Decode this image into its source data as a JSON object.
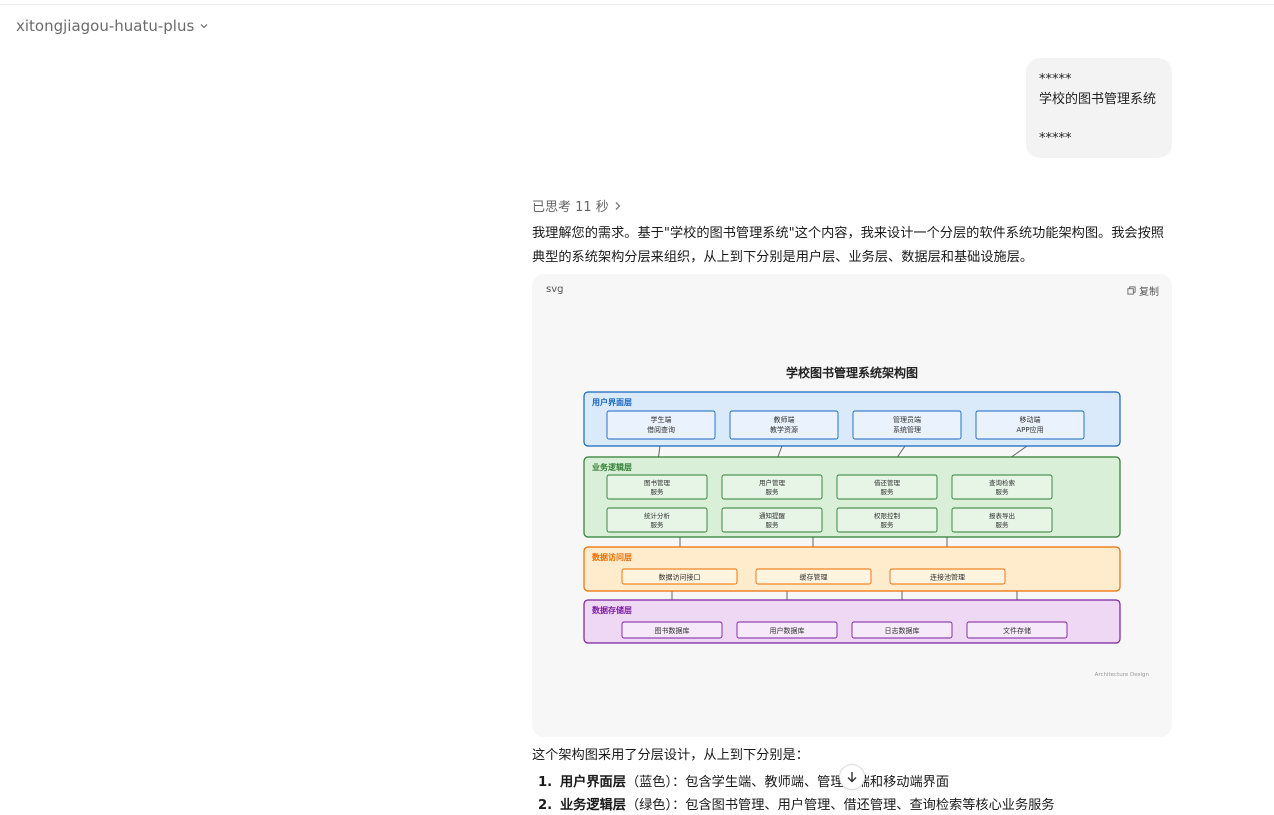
{
  "header": {
    "model_name": "xitongjiagou-huatu-plus"
  },
  "user_message": {
    "line1": "*****",
    "line2": "学校的图书管理系统",
    "line3": "*****"
  },
  "assistant": {
    "thought_label": "已思考 11 秒",
    "intro": "我理解您的需求。基于\"学校的图书管理系统\"这个内容，我来设计一个分层的软件系统功能架构图。我会按照典型的系统架构分层来组织，从上到下分别是用户层、业务层、数据层和基础设施层。",
    "code_block": {
      "language": "svg",
      "copy_label": "复制",
      "diagram": {
        "title": "学校图书管理系统架构图",
        "footer": "Architecture Design",
        "layers": [
          {
            "name": "用户界面层",
            "color": "#1565c0",
            "fill": "#dbeafb",
            "boxes": [
              [
                "学生端",
                "借阅查询"
              ],
              [
                "教师端",
                "教学资源"
              ],
              [
                "管理员端",
                "系统管理"
              ],
              [
                "移动端",
                "APP应用"
              ]
            ]
          },
          {
            "name": "业务逻辑层",
            "color": "#2e7d32",
            "fill": "#d9efd8",
            "boxes": [
              [
                "图书管理",
                "服务"
              ],
              [
                "用户管理",
                "服务"
              ],
              [
                "借还管理",
                "服务"
              ],
              [
                "查询检索",
                "服务"
              ],
              [
                "统计分析",
                "服务"
              ],
              [
                "通知提醒",
                "服务"
              ],
              [
                "权限控制",
                "服务"
              ],
              [
                "报表导出",
                "服务"
              ]
            ]
          },
          {
            "name": "数据访问层",
            "color": "#ef6c00",
            "fill": "#ffeccc",
            "boxes": [
              [
                "数据访问接口"
              ],
              [
                "缓存管理"
              ],
              [
                "连接池管理"
              ]
            ]
          },
          {
            "name": "数据存储层",
            "color": "#7b1fa2",
            "fill": "#eed8f3",
            "boxes": [
              [
                "图书数据库"
              ],
              [
                "用户数据库"
              ],
              [
                "日志数据库"
              ],
              [
                "文件存储"
              ]
            ]
          }
        ]
      }
    },
    "summary": "这个架构图采用了分层设计，从上到下分别是：",
    "list": [
      {
        "num": "1.",
        "term": "用户界面层",
        "desc": "（蓝色）：包含学生端、教师端、管理员端和移动端界面"
      },
      {
        "num": "2.",
        "term": "业务逻辑层",
        "desc": "（绿色）：包含图书管理、用户管理、借还管理、查询检索等核心业务服务"
      }
    ]
  },
  "icons": {
    "chevron": "chevron-down-icon",
    "thought": "chevron-right-icon",
    "copy": "copy-icon",
    "scroll": "arrow-down-icon"
  }
}
